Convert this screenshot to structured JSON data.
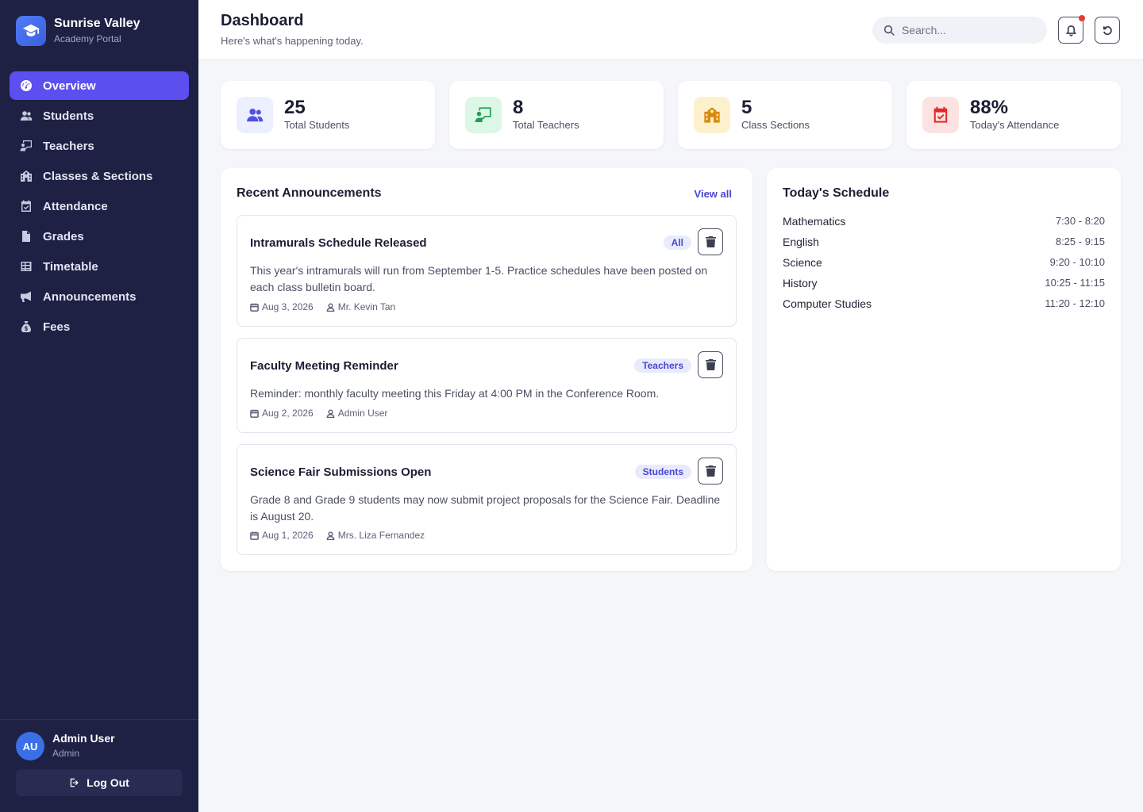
{
  "brand": {
    "title": "Sunrise Valley",
    "subtitle": "Academy Portal"
  },
  "nav": [
    {
      "label": "Overview",
      "icon": "gauge-icon",
      "active": true
    },
    {
      "label": "Students",
      "icon": "users-icon"
    },
    {
      "label": "Teachers",
      "icon": "chalkboard-teacher-icon"
    },
    {
      "label": "Classes & Sections",
      "icon": "school-icon"
    },
    {
      "label": "Attendance",
      "icon": "calendar-check-icon"
    },
    {
      "label": "Grades",
      "icon": "file-icon"
    },
    {
      "label": "Timetable",
      "icon": "table-icon"
    },
    {
      "label": "Announcements",
      "icon": "megaphone-icon"
    },
    {
      "label": "Fees",
      "icon": "money-bag-icon"
    }
  ],
  "user": {
    "initials": "AU",
    "name": "Admin User",
    "role": "Admin",
    "logout_label": "Log Out"
  },
  "header": {
    "title": "Dashboard",
    "subtitle": "Here's what's happening today.",
    "search_placeholder": "Search..."
  },
  "stats": [
    {
      "value": "25",
      "label": "Total Students",
      "icon": "users-icon",
      "bg": "#eceffd",
      "fg": "#4f52e0"
    },
    {
      "value": "8",
      "label": "Total Teachers",
      "icon": "chalkboard-teacher-icon",
      "bg": "#dcf7e6",
      "fg": "#1f9d55"
    },
    {
      "value": "5",
      "label": "Class Sections",
      "icon": "school-icon",
      "bg": "#fdf0cc",
      "fg": "#d98a0b"
    },
    {
      "value": "88%",
      "label": "Today's Attendance",
      "icon": "calendar-check-icon",
      "bg": "#fde2e2",
      "fg": "#e02b2b"
    }
  ],
  "announcements": {
    "title": "Recent Announcements",
    "view_all": "View all",
    "items": [
      {
        "title": "Intramurals Schedule Released",
        "badge": "All",
        "body": "This year's intramurals will run from September 1-5. Practice schedules have been posted on each class bulletin board.",
        "date": "Aug 3, 2026",
        "author": "Mr. Kevin Tan"
      },
      {
        "title": "Faculty Meeting Reminder",
        "badge": "Teachers",
        "body": "Reminder: monthly faculty meeting this Friday at 4:00 PM in the Conference Room.",
        "date": "Aug 2, 2026",
        "author": "Admin User"
      },
      {
        "title": "Science Fair Submissions Open",
        "badge": "Students",
        "body": "Grade 8 and Grade 9 students may now submit project proposals for the Science Fair. Deadline is August 20.",
        "date": "Aug 1, 2026",
        "author": "Mrs. Liza Fernandez"
      }
    ]
  },
  "schedule": {
    "title": "Today's Schedule",
    "items": [
      {
        "subject": "Mathematics",
        "time": "7:30 - 8:20"
      },
      {
        "subject": "English",
        "time": "8:25 - 9:15"
      },
      {
        "subject": "Science",
        "time": "9:20 - 10:10"
      },
      {
        "subject": "History",
        "time": "10:25 - 11:15"
      },
      {
        "subject": "Computer Studies",
        "time": "11:20 - 12:10"
      }
    ]
  }
}
